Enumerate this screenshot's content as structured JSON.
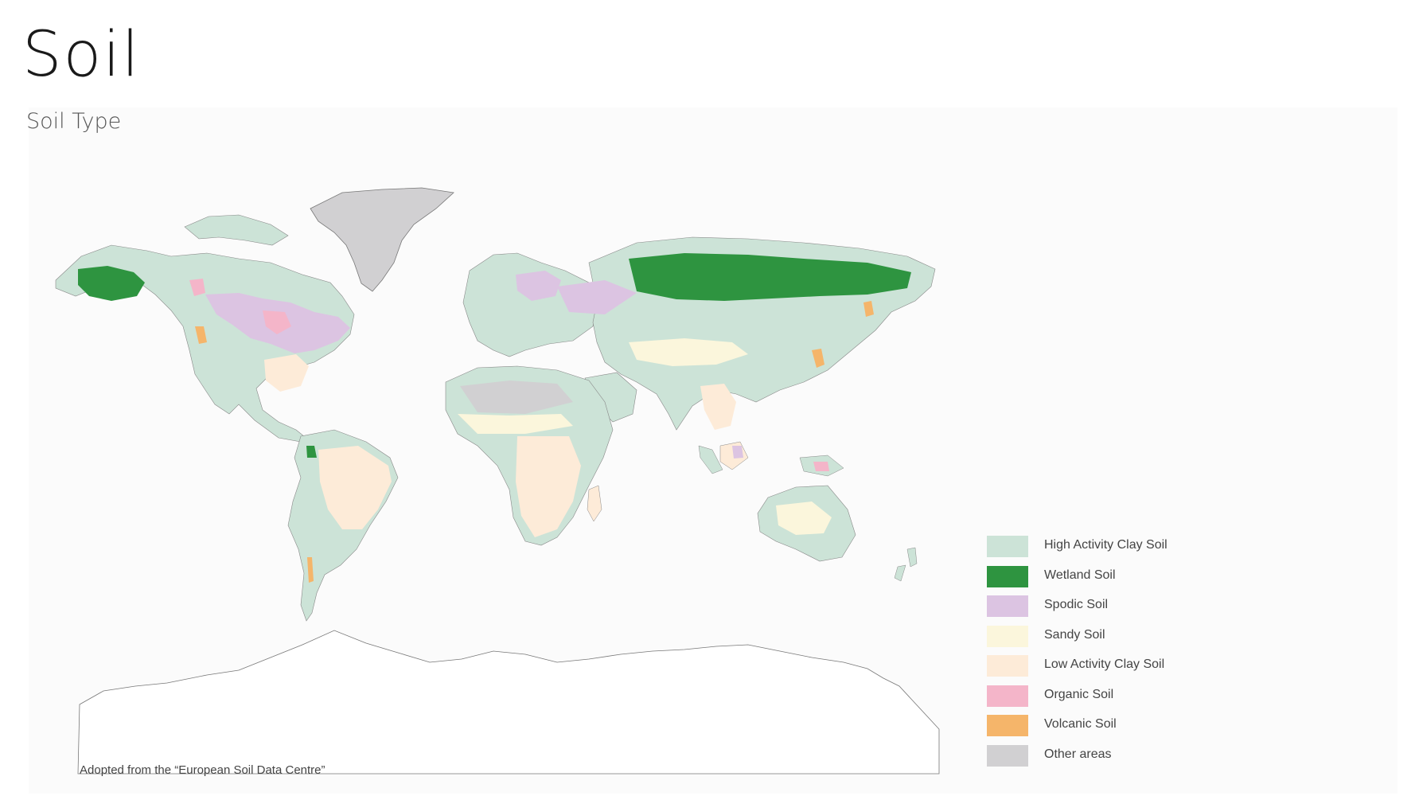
{
  "header": {
    "title": "Soil",
    "subtitle": "Soil Type"
  },
  "legend": {
    "items": [
      {
        "label": "High Activity Clay Soil",
        "color": "#cce3d7"
      },
      {
        "label": "Wetland Soil",
        "color": "#2e9440"
      },
      {
        "label": "Spodic Soil",
        "color": "#dcc4e2"
      },
      {
        "label": "Sandy Soil",
        "color": "#fbf6dc"
      },
      {
        "label": "Low Activity Clay Soil",
        "color": "#fdebd8"
      },
      {
        "label": "Organic Soil",
        "color": "#f4b5c9"
      },
      {
        "label": "Volcanic Soil",
        "color": "#f5b56a"
      },
      {
        "label": "Other areas",
        "color": "#d1d0d2"
      }
    ]
  },
  "source": "Adopted from the “European Soil Data Centre”"
}
